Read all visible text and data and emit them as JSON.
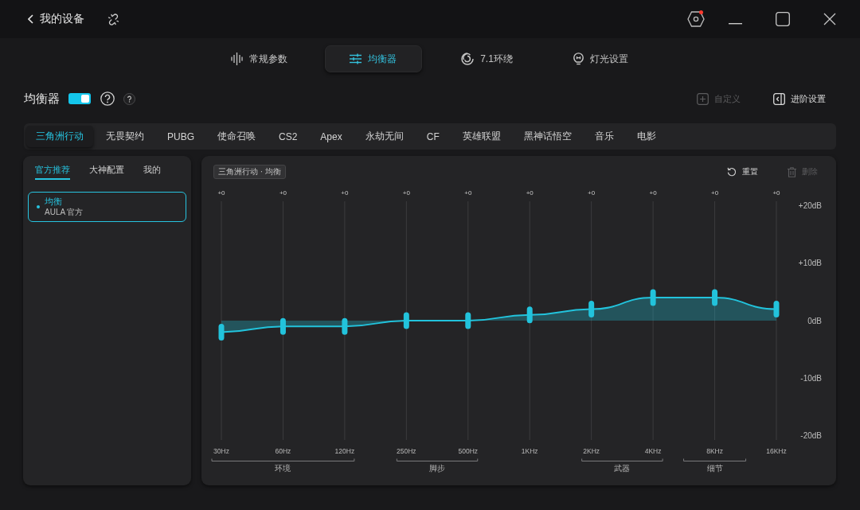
{
  "title_bar": {
    "back_label": "我的设备",
    "alert": true
  },
  "nav_tabs": [
    {
      "label": "常规参数",
      "selected": false
    },
    {
      "label": "均衡器",
      "selected": true
    },
    {
      "label": "7.1环绕",
      "selected": false
    },
    {
      "label": "灯光设置",
      "selected": false
    }
  ],
  "equalizer_header": {
    "title": "均衡器",
    "enabled": true,
    "buttons": [
      {
        "label": "自定义",
        "disabled": true
      },
      {
        "label": "进阶设置",
        "disabled": false
      }
    ]
  },
  "game_tabs": [
    {
      "label": "三角洲行动",
      "selected": true
    },
    {
      "label": "无畏契约",
      "selected": false
    },
    {
      "label": "PUBG",
      "selected": false
    },
    {
      "label": "使命召唤",
      "selected": false
    },
    {
      "label": "CS2",
      "selected": false
    },
    {
      "label": "Apex",
      "selected": false
    },
    {
      "label": "永劫无间",
      "selected": false
    },
    {
      "label": "CF",
      "selected": false
    },
    {
      "label": "英雄联盟",
      "selected": false
    },
    {
      "label": "黑神话悟空",
      "selected": false
    },
    {
      "label": "音乐",
      "selected": false
    },
    {
      "label": "电影",
      "selected": false
    }
  ],
  "preset_panel": {
    "tabs": [
      {
        "label": "官方推荐",
        "selected": true
      },
      {
        "label": "大神配置",
        "selected": false
      },
      {
        "label": "我的",
        "selected": false
      }
    ],
    "presets": [
      {
        "name": "均衡",
        "author": "AULA 官方",
        "selected": true
      }
    ]
  },
  "eq_panel": {
    "badge": "三角洲行动 · 均衡",
    "actions": [
      {
        "label": "重置",
        "disabled": false
      },
      {
        "label": "删除",
        "disabled": true
      }
    ],
    "gain_readouts": [
      "+0",
      "+0",
      "+0",
      "+0",
      "+0",
      "+0",
      "+0",
      "+0",
      "+0",
      "+0"
    ],
    "chart_data": {
      "type": "area",
      "categories": [
        "30Hz",
        "60Hz",
        "120Hz",
        "250Hz",
        "500Hz",
        "1KHz",
        "2KHz",
        "4KHz",
        "8KHz",
        "16KHz"
      ],
      "values": [
        -2,
        -1,
        -1,
        0,
        0,
        1,
        2,
        4,
        4,
        2
      ],
      "color": "#22c3dc",
      "ylim": [
        -20,
        20
      ],
      "yticks": [
        {
          "value": 20,
          "label": "+20dB"
        },
        {
          "value": 10,
          "label": "+10dB"
        },
        {
          "value": 0,
          "label": "0dB"
        },
        {
          "value": -10,
          "label": "-10dB"
        },
        {
          "value": -20,
          "label": "-20dB"
        }
      ],
      "grid": true,
      "annotations": [
        "环境",
        "脚步",
        "武器",
        "细节"
      ]
    }
  }
}
